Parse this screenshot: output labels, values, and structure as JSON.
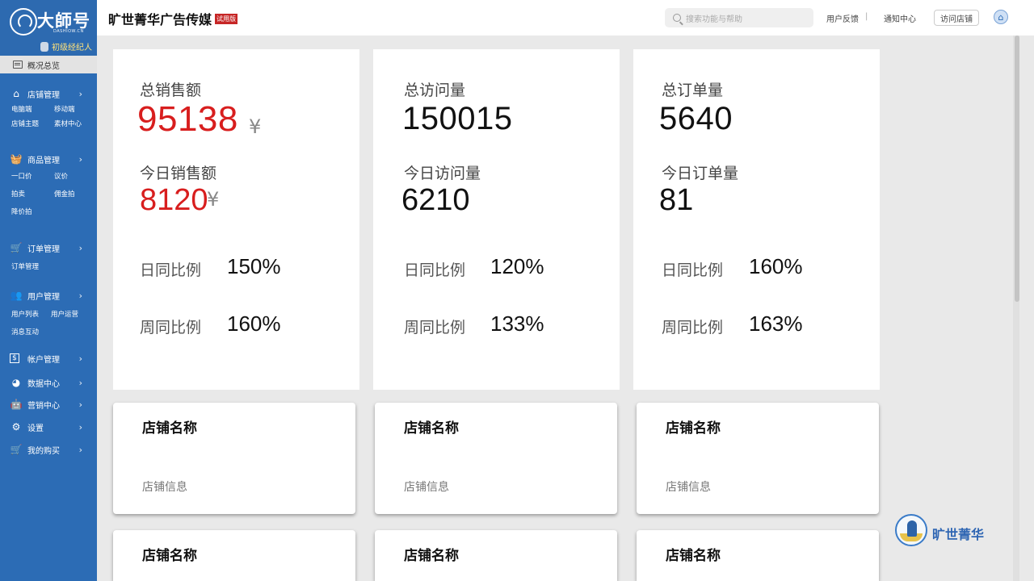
{
  "sidebar": {
    "logo_text": "大師号",
    "logo_sub": "DASHIOW.CN",
    "role": "初级经纪人",
    "overview": "概况总览",
    "groups": [
      {
        "label": "店铺管理",
        "items": [
          "电脑端",
          "移动端",
          "店铺主题",
          "素材中心"
        ]
      },
      {
        "label": "商品管理",
        "items": [
          "一口价",
          "议价",
          "拍卖",
          "佣金拍",
          "降价拍"
        ]
      },
      {
        "label": "订单管理",
        "items": [
          "订单管理"
        ]
      },
      {
        "label": "用户管理",
        "items": [
          "用户列表",
          "用户运营",
          "消息互动"
        ]
      },
      {
        "label": "帐户管理",
        "items": []
      },
      {
        "label": "数据中心",
        "items": []
      },
      {
        "label": "营销中心",
        "items": []
      },
      {
        "label": "设置",
        "items": []
      },
      {
        "label": "我的购买",
        "items": []
      }
    ]
  },
  "header": {
    "brand": "旷世菁华广告传媒",
    "trial_badge": "试用版",
    "search_placeholder": "搜索功能与帮助",
    "feedback": "用户反馈",
    "notifications": "通知中心",
    "visit_store": "访问店铺"
  },
  "stats": [
    {
      "total_label": "总销售额",
      "total_value": "95138",
      "total_unit": "¥",
      "today_label": "今日销售额",
      "today_value": "8120",
      "today_unit": "¥",
      "day_label": "日同比例",
      "day_value": "150%",
      "week_label": "周同比例",
      "week_value": "160%"
    },
    {
      "total_label": "总访问量",
      "total_value": "150015",
      "today_label": "今日访问量",
      "today_value": "6210",
      "day_label": "日同比例",
      "day_value": "120%",
      "week_label": "周同比例",
      "week_value": "133%"
    },
    {
      "total_label": "总订单量",
      "total_value": "5640",
      "today_label": "今日订单量",
      "today_value": "81",
      "day_label": "日同比例",
      "day_value": "160%",
      "week_label": "周同比例",
      "week_value": "163%"
    }
  ],
  "shops": [
    {
      "name": "店铺名称",
      "info": "店铺信息"
    },
    {
      "name": "店铺名称",
      "info": "店铺信息"
    },
    {
      "name": "店铺名称",
      "info": "店铺信息"
    },
    {
      "name": "店铺名称"
    },
    {
      "name": "店铺名称"
    },
    {
      "name": "店铺名称"
    }
  ],
  "watermark": "旷世菁华",
  "colors": {
    "sidebar": "#2c6cb5",
    "accent_red": "#d81e1e",
    "trial_badge": "#c62626"
  }
}
